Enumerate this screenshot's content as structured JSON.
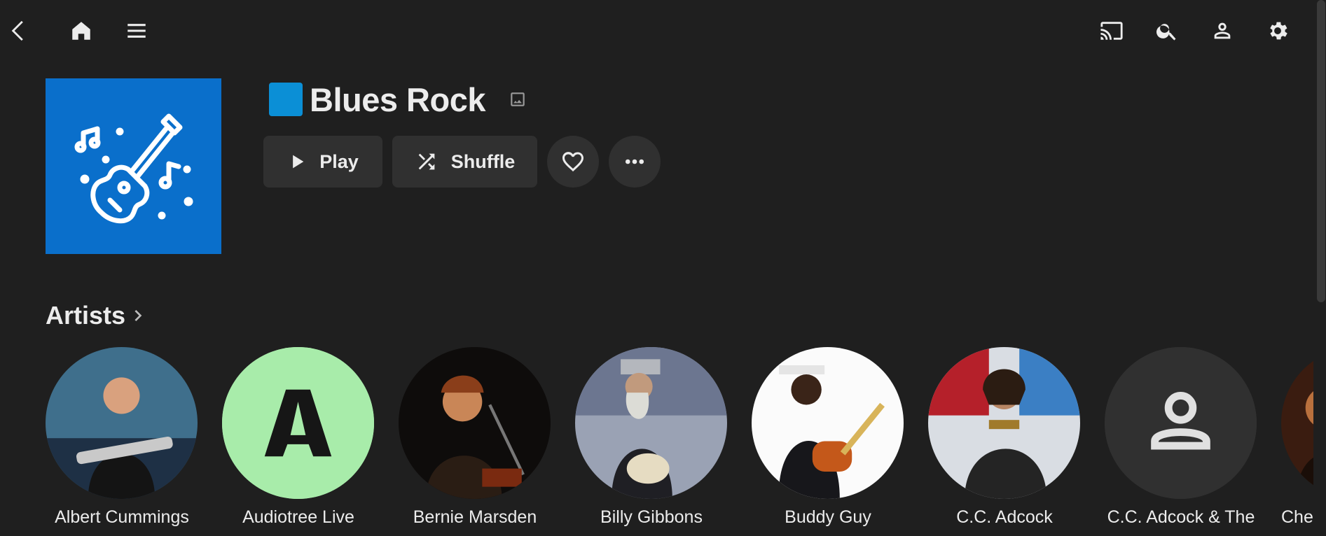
{
  "header": {
    "back_icon": "back-arrow-icon",
    "home_icon": "home-icon",
    "menu_icon": "hamburger-menu-icon",
    "cast_icon": "cast-icon",
    "search_icon": "search-icon",
    "user_icon": "user-icon",
    "settings_icon": "gear-icon"
  },
  "genre": {
    "title": "Blues Rock",
    "swatch_color": "#0b8fd6",
    "cover_color": "#0a6fcb"
  },
  "actions": {
    "play_label": "Play",
    "shuffle_label": "Shuffle"
  },
  "artists_section": {
    "title": "Artists",
    "items": [
      {
        "name": "Albert Cummings"
      },
      {
        "name": "Audiotree Live"
      },
      {
        "name": "Bernie Marsden"
      },
      {
        "name": "Billy Gibbons"
      },
      {
        "name": "Buddy Guy"
      },
      {
        "name": "C.C. Adcock"
      },
      {
        "name": "C.C. Adcock & The"
      },
      {
        "name": "Che"
      }
    ]
  }
}
